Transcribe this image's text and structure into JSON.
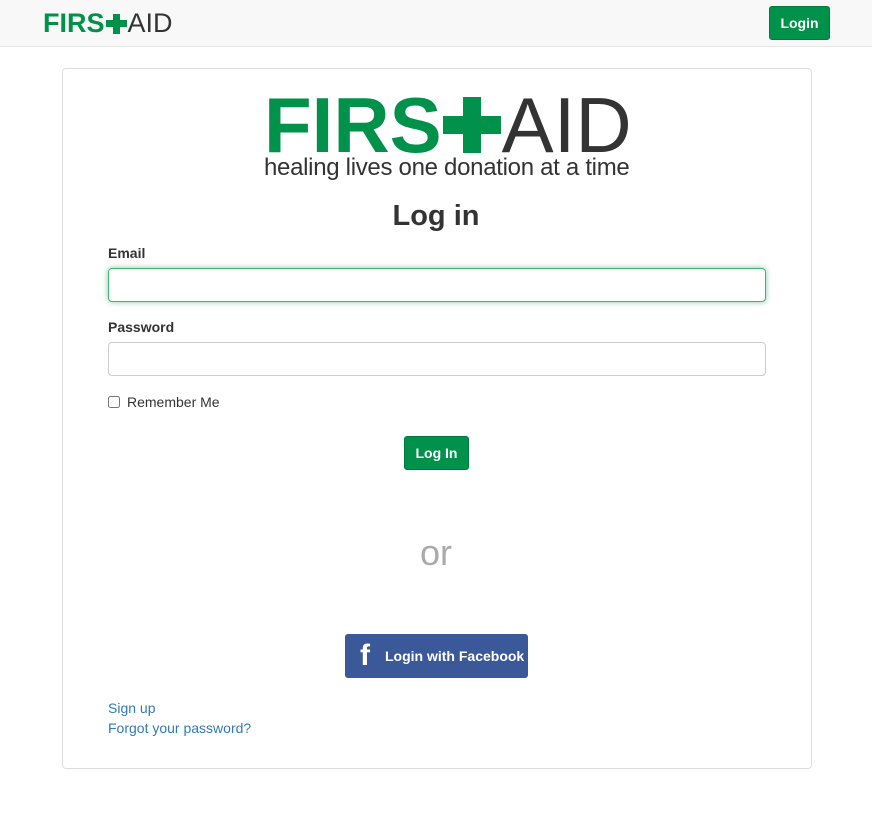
{
  "navbar": {
    "logo_bold": "FIRS",
    "logo_light": "AID",
    "login_label": "Login"
  },
  "brand": {
    "logo_bold": "FIRS",
    "logo_light": "AID",
    "tagline": "healing lives one donation at a time",
    "color": "#00924a"
  },
  "form": {
    "title": "Log in",
    "email_label": "Email",
    "email_value": "",
    "password_label": "Password",
    "password_value": "",
    "remember_label": "Remember Me",
    "remember_checked": false,
    "submit_label": "Log In"
  },
  "divider_text": "or",
  "facebook": {
    "icon": "facebook-icon",
    "label": "Login with Facebook",
    "color": "#3b5998"
  },
  "links": {
    "signup": "Sign up",
    "forgot": "Forgot your password?"
  }
}
